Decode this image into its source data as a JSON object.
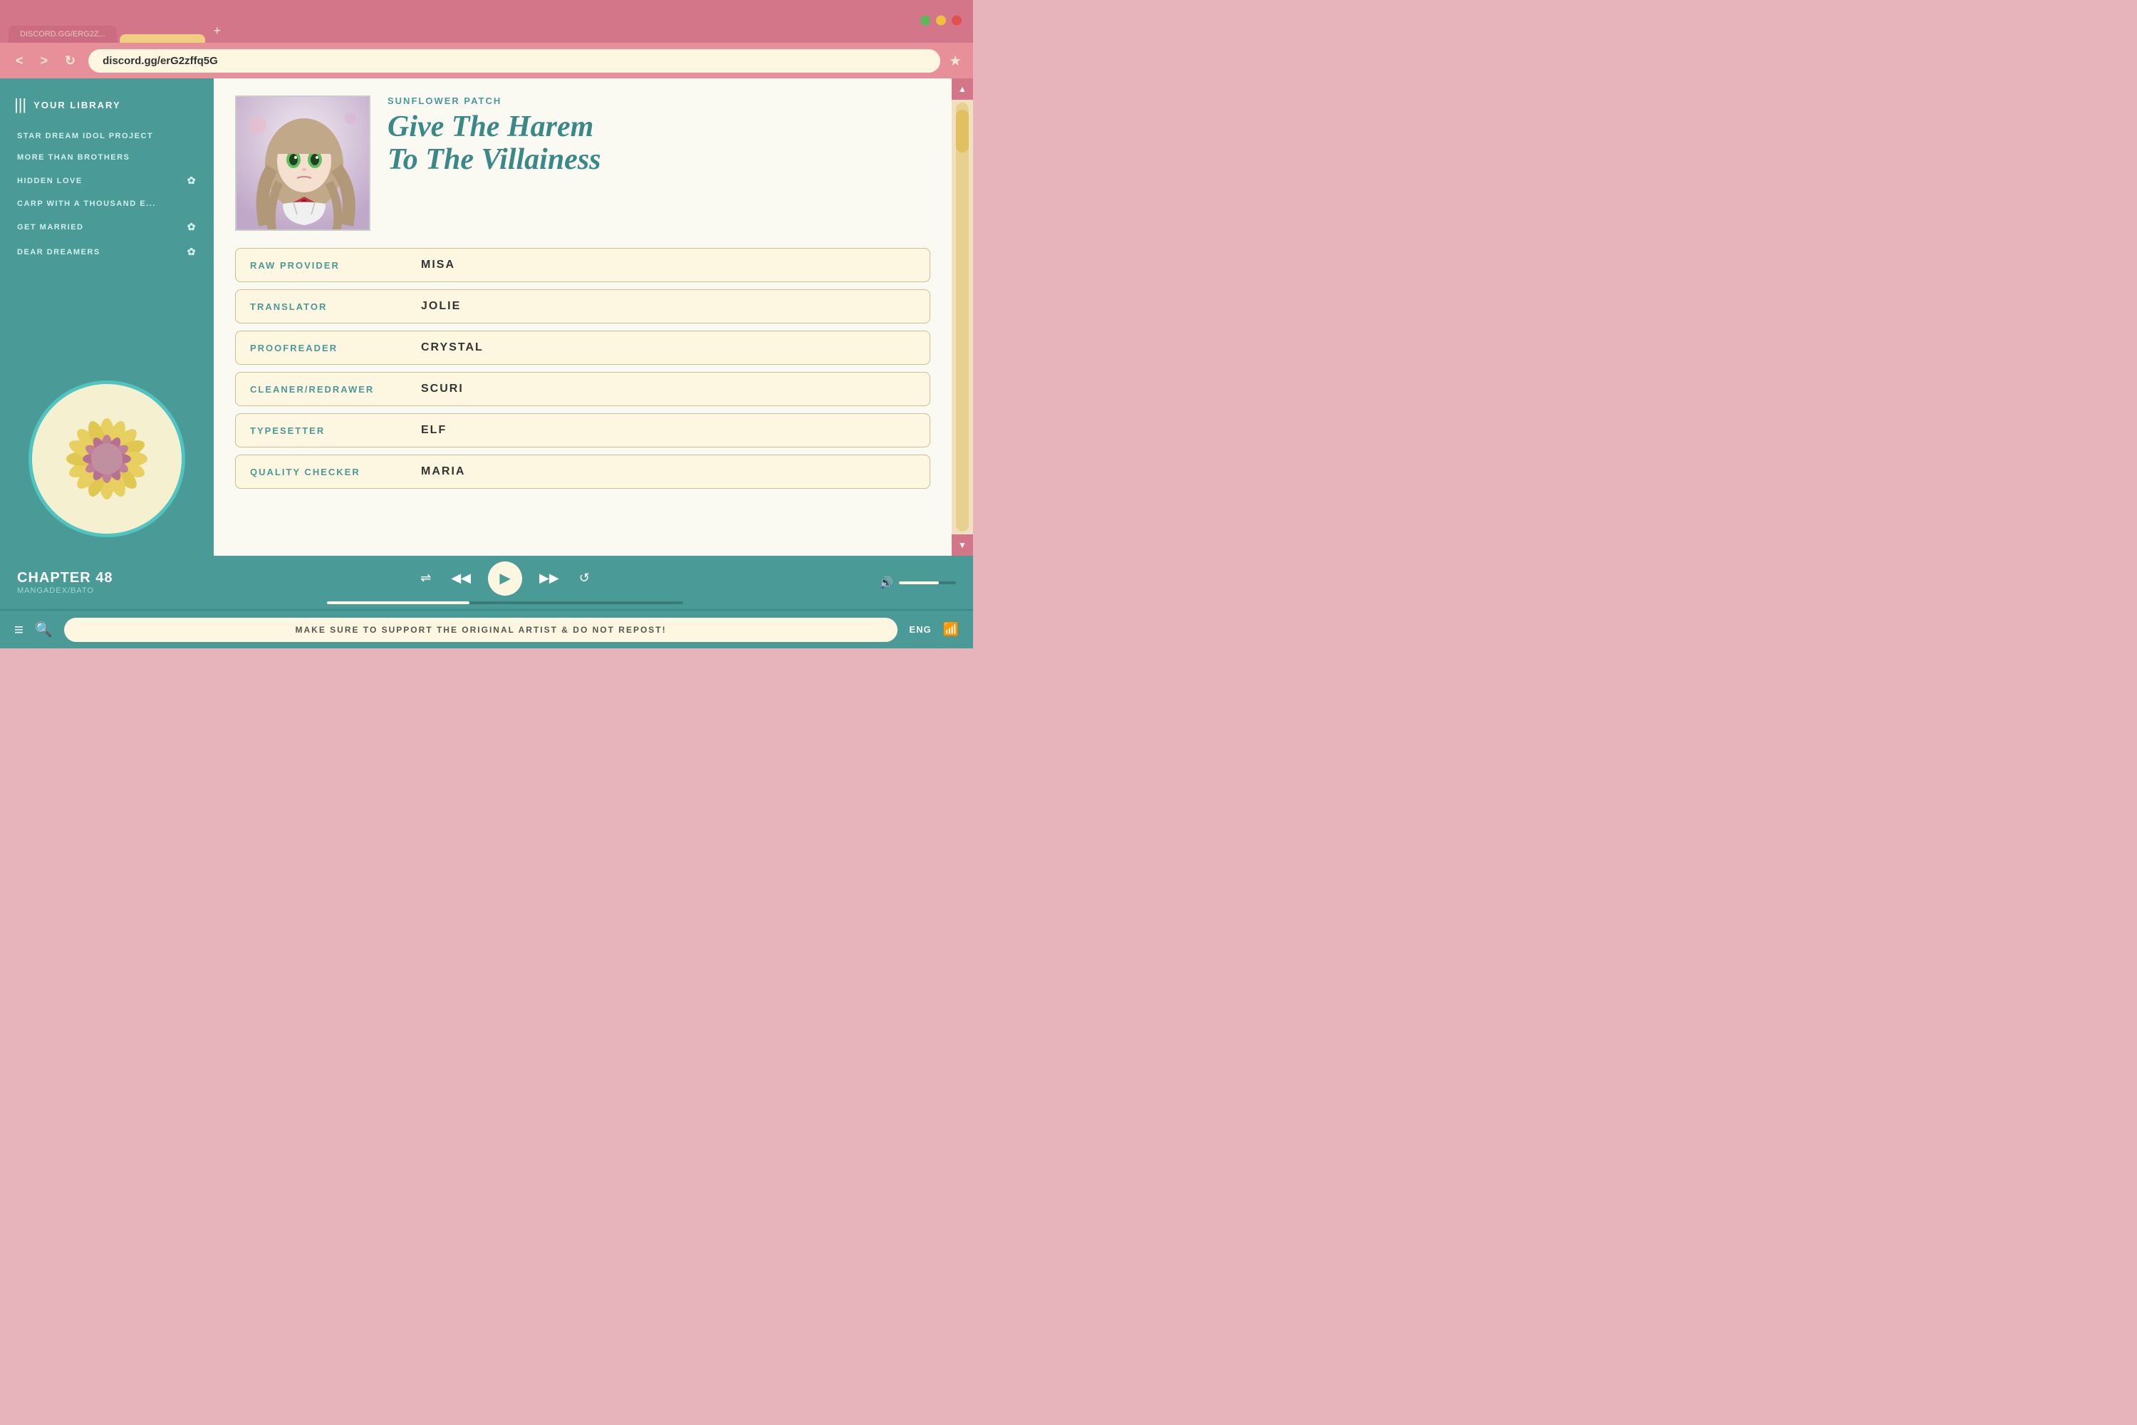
{
  "browser": {
    "tabs": [
      {
        "label": "DISCORD.GG/ERG2Z...",
        "active": false
      },
      {
        "label": "",
        "active": true
      }
    ],
    "new_tab_icon": "+",
    "address": "discord.gg/erG2zffq5G",
    "nav_back": "<",
    "nav_forward": ">",
    "nav_refresh": "↻",
    "bookmark_icon": "★",
    "window_controls": {
      "green": "#5cb85c",
      "yellow": "#f0c040",
      "red": "#e05050"
    }
  },
  "sidebar": {
    "library_title": "YOUR LIBRARY",
    "items": [
      {
        "label": "STAR DREAM IDOL PROJECT",
        "has_star": false
      },
      {
        "label": "MORE THAN BROTHERS",
        "has_star": false
      },
      {
        "label": "HIDDEN LOVE",
        "has_star": true
      },
      {
        "label": "CARP WITH A THOUSAND E...",
        "has_star": false
      },
      {
        "label": "GET MARRIED",
        "has_star": true
      },
      {
        "label": "DEAR DREAMERS",
        "has_star": true
      }
    ]
  },
  "manga": {
    "group_name": "SUNFLOWER PATCH",
    "title_line1": "Give The Harem",
    "title_line2": "To The Villainess",
    "credits": [
      {
        "role": "RAW PROVIDER",
        "name": "MISA"
      },
      {
        "role": "TRANSLATOR",
        "name": "JOLIE"
      },
      {
        "role": "PROOFREADER",
        "name": "CRYSTAL"
      },
      {
        "role": "CLEANER/REDRAWER",
        "name": "SCURI"
      },
      {
        "role": "TYPESETTER",
        "name": "ELF"
      },
      {
        "role": "QUALITY CHECKER",
        "name": "MARIA"
      }
    ]
  },
  "player": {
    "chapter_label": "CHAPTER 48",
    "chapter_source": "MANGADEX/BATO",
    "shuffle_icon": "⇌",
    "prev_icon": "◀◀",
    "play_icon": "▶",
    "next_icon": "▶▶",
    "repeat_icon": "↺",
    "progress_percent": 40,
    "volume_percent": 70,
    "volume_label": "🔊"
  },
  "bottom_bar": {
    "menu_icon": "≡",
    "search_icon": "🔍",
    "notice": "MAKE SURE TO SUPPORT THE ORIGINAL ARTIST & DO NOT REPOST!",
    "lang": "ENG",
    "wifi_icon": "📶"
  }
}
